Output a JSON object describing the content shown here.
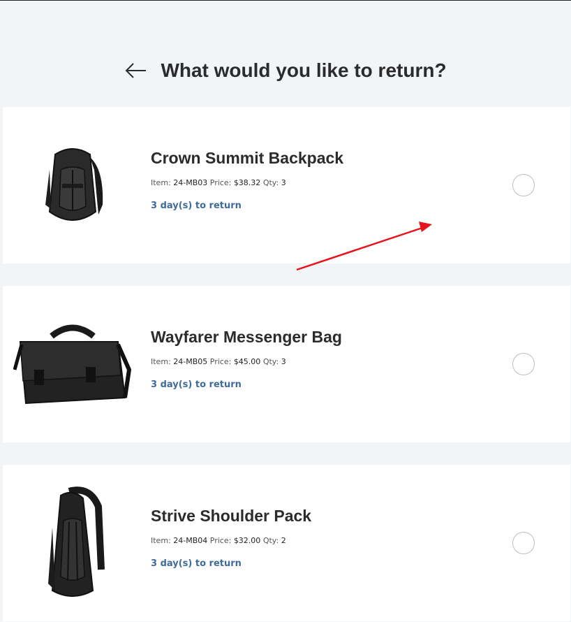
{
  "header": {
    "title": "What would you like to return?",
    "back_icon": "arrow-left-icon"
  },
  "items": [
    {
      "name": "Crown Summit Backpack",
      "item_label": "Item:",
      "item_code": "24-MB03",
      "price_label": "Price:",
      "price": "$38.32",
      "qty_label": "Qty:",
      "qty": "3",
      "days": "3 day(s) to return",
      "image": "backpack-image",
      "selected": false
    },
    {
      "name": "Wayfarer Messenger Bag",
      "item_label": "Item:",
      "item_code": "24-MB05",
      "price_label": "Price:",
      "price": "$45.00",
      "qty_label": "Qty:",
      "qty": "3",
      "days": "3 day(s) to return",
      "image": "messenger-bag-image",
      "selected": false
    },
    {
      "name": "Strive Shoulder Pack",
      "item_label": "Item:",
      "item_code": "24-MB04",
      "price_label": "Price:",
      "price": "$32.00",
      "qty_label": "Qty:",
      "qty": "2",
      "days": "3 day(s) to return",
      "image": "shoulder-pack-image",
      "selected": false
    }
  ],
  "colors": {
    "background": "#f2f5f8",
    "card": "#ffffff",
    "link": "#3f6a9c",
    "annotation_arrow": "#e8141b"
  }
}
